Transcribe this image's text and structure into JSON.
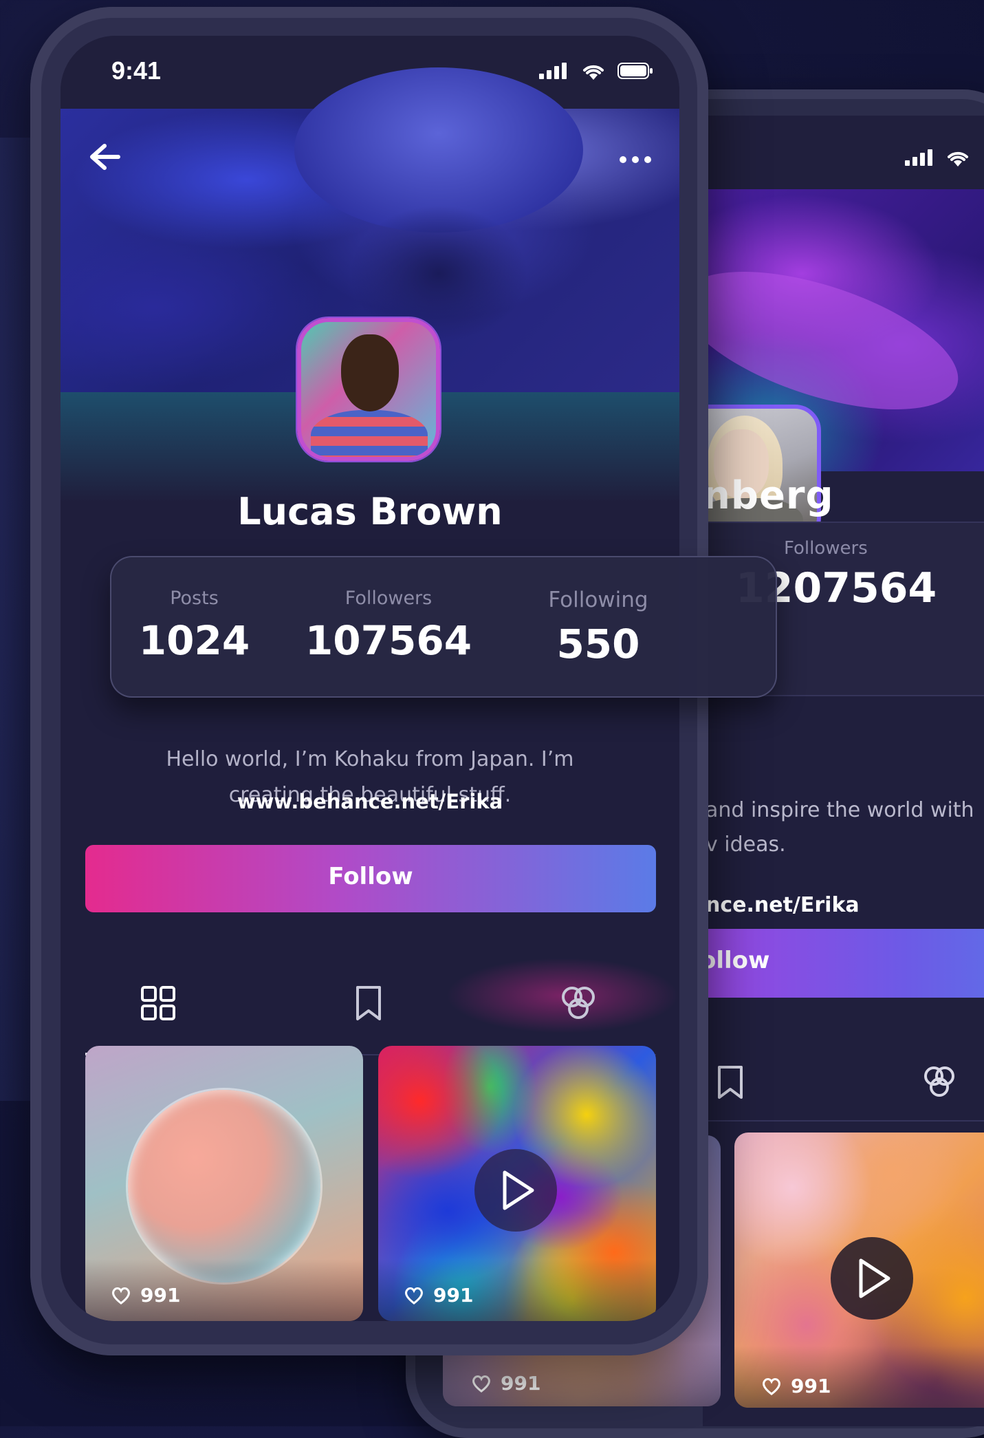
{
  "front": {
    "status": {
      "time": "9:41"
    },
    "profile": {
      "name": "Lucas Brown",
      "stats": [
        {
          "label": "Posts",
          "value": "1024"
        },
        {
          "label": "Followers",
          "value": "107564"
        },
        {
          "label": "Following",
          "value": "550"
        }
      ],
      "bio_line1": "Hello world, I’m Kohaku from Japan. I’m",
      "bio_line2": "creating the beautiful stuff.",
      "link": "www.behance.net/Erika",
      "follow_label": "Follow"
    },
    "tabs": [
      "grid-icon",
      "bookmark-icon",
      "collab-icon"
    ],
    "active_tab": 0,
    "posts": [
      {
        "likes": "991",
        "video": false
      },
      {
        "likes": "991",
        "video": true
      }
    ]
  },
  "back": {
    "profile": {
      "name_partial": "nberg",
      "followers_label": "Followers",
      "followers_value": "1207564",
      "bio_line1": "and inspire the world with",
      "bio_line2": "v ideas.",
      "link_partial": "nce.net/Erika",
      "follow_partial": "ollow"
    },
    "posts": [
      {
        "likes": "991",
        "video": false
      },
      {
        "likes": "991",
        "video": true
      }
    ]
  },
  "colors": {
    "background": "#14163a",
    "follow_gradient_start": "#e42b8e",
    "follow_gradient_end": "#5b7be7",
    "avatar_ring": "#c04fd0"
  }
}
